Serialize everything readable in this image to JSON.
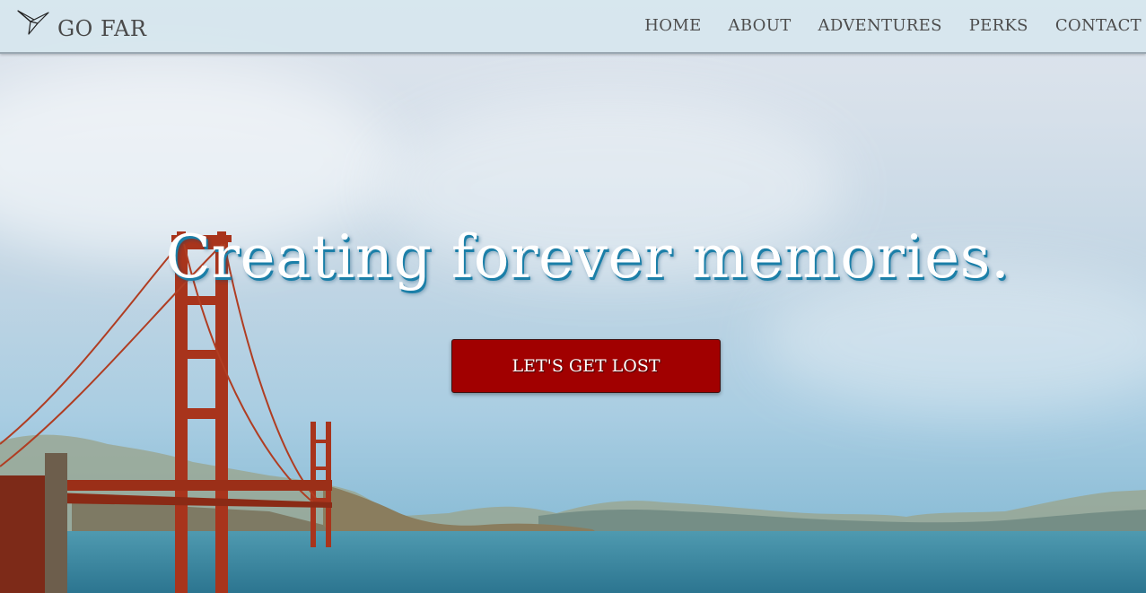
{
  "brand": {
    "name": "GO FAR",
    "icon": "origami-bird-icon"
  },
  "nav": {
    "items": [
      {
        "label": "HOME"
      },
      {
        "label": "ABOUT"
      },
      {
        "label": "ADVENTURES"
      },
      {
        "label": "PERKS"
      },
      {
        "label": "CONTACT"
      }
    ]
  },
  "hero": {
    "headline": "Creating forever memories.",
    "cta_label": "LET'S GET LOST",
    "image_subject": "golden-gate-bridge-photo"
  },
  "colors": {
    "cta_background": "#a10000",
    "headline_shadow": "#1b7fa8",
    "bridge": "#a8341c"
  }
}
